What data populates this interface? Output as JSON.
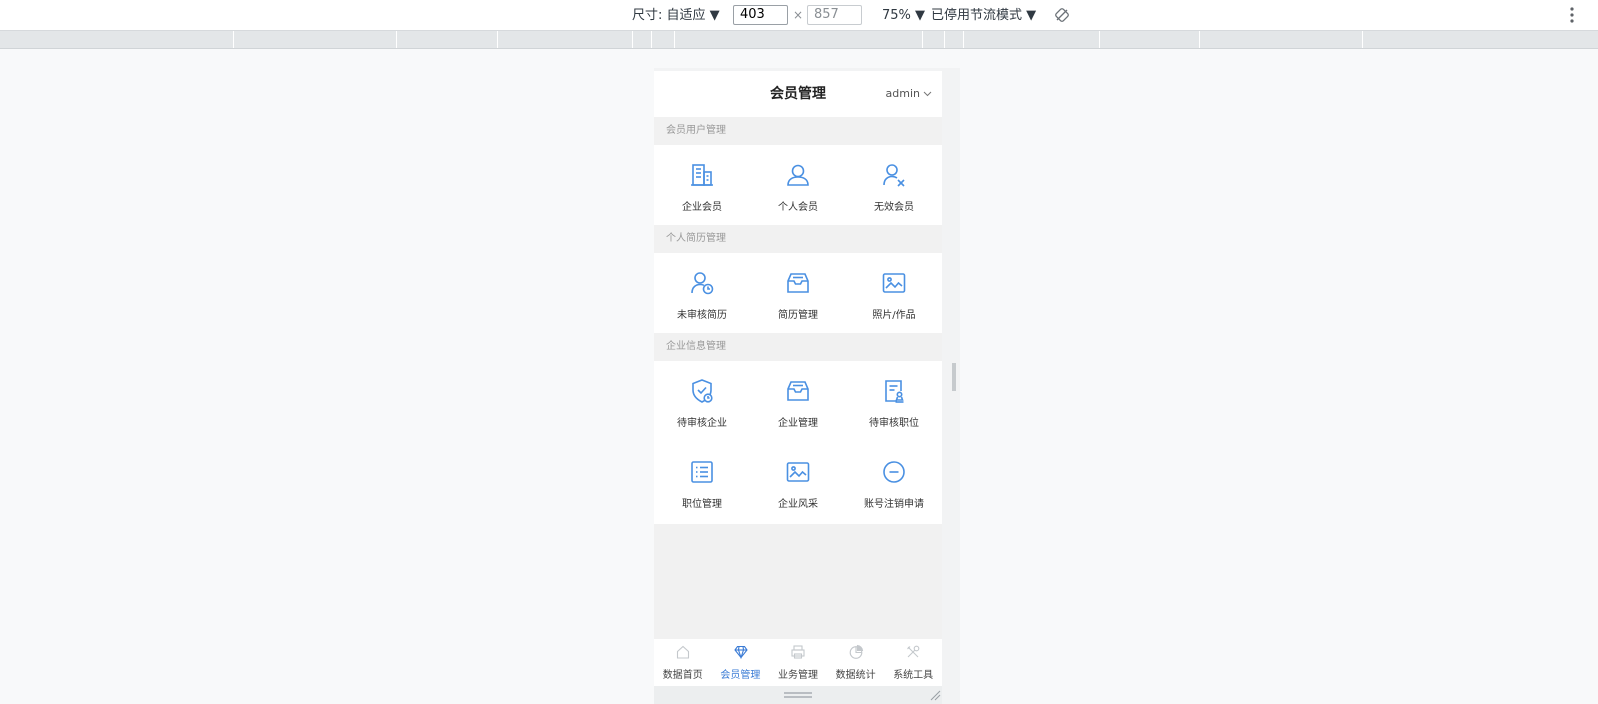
{
  "devtools": {
    "dimensions_label": "尺寸: 自适应 ▼",
    "width_value": "403",
    "height_value": "857",
    "times": "×",
    "zoom": "75% ▼",
    "throttle": "已停用节流模式 ▼"
  },
  "header": {
    "title": "会员管理",
    "user": "admin"
  },
  "sections": [
    {
      "title": "会员用户管理",
      "items": [
        {
          "label": "企业会员",
          "icon": "building-icon"
        },
        {
          "label": "个人会员",
          "icon": "user-icon"
        },
        {
          "label": "无效会员",
          "icon": "user-x-icon"
        }
      ]
    },
    {
      "title": "个人简历管理",
      "items": [
        {
          "label": "未审核简历",
          "icon": "user-clock-icon"
        },
        {
          "label": "简历管理",
          "icon": "inbox-icon"
        },
        {
          "label": "照片/作品",
          "icon": "image-icon"
        }
      ]
    },
    {
      "title": "企业信息管理",
      "items": [
        {
          "label": "待审核企业",
          "icon": "shield-clock-icon"
        },
        {
          "label": "企业管理",
          "icon": "inbox-icon"
        },
        {
          "label": "待审核职位",
          "icon": "document-stamp-icon"
        },
        {
          "label": "职位管理",
          "icon": "list-icon"
        },
        {
          "label": "企业风采",
          "icon": "image-icon"
        },
        {
          "label": "账号注销申请",
          "icon": "minus-circle-icon"
        }
      ]
    }
  ],
  "tabbar": [
    {
      "label": "数据首页",
      "icon": "home-icon",
      "active": false
    },
    {
      "label": "会员管理",
      "icon": "diamond-icon",
      "active": true
    },
    {
      "label": "业务管理",
      "icon": "printer-icon",
      "active": false
    },
    {
      "label": "数据统计",
      "icon": "pie-chart-icon",
      "active": false
    },
    {
      "label": "系统工具",
      "icon": "tools-icon",
      "active": false
    }
  ],
  "colors": {
    "accent": "#3a7bd5",
    "icon_blue": "#4a90e2",
    "tab_inactive": "#c4c8cc"
  }
}
